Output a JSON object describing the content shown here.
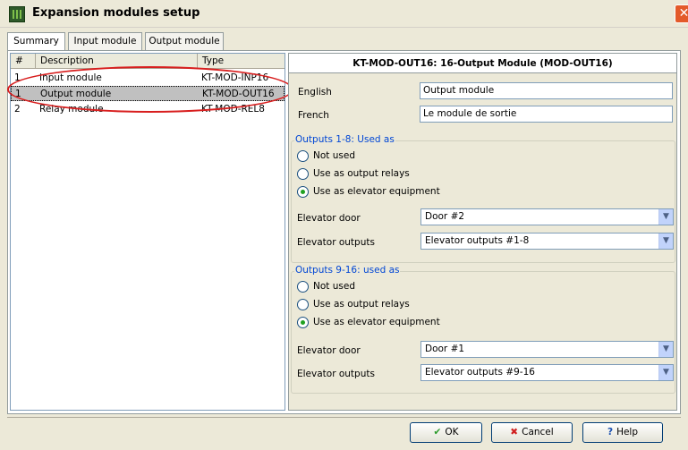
{
  "window": {
    "title": "Expansion modules setup",
    "close": "✕"
  },
  "tabs": [
    {
      "label": "Summary"
    },
    {
      "label": "Input module"
    },
    {
      "label": "Output module"
    }
  ],
  "list": {
    "headers": {
      "num": "#",
      "description": "Description",
      "type": "Type"
    },
    "rows": [
      {
        "num": "1",
        "description": "Input module",
        "type": "KT-MOD-INP16"
      },
      {
        "num": "1",
        "description": "Output module",
        "type": "KT-MOD-OUT16"
      },
      {
        "num": "2",
        "description": "Relay module",
        "type": "KT-MOD-REL8"
      }
    ],
    "selected_index": 1
  },
  "detail": {
    "heading": "KT-MOD-OUT16: 16-Output Module (MOD-OUT16)",
    "english_label": "English",
    "english_value": "Output module",
    "french_label": "French",
    "french_value": "Le module de sortie"
  },
  "group1": {
    "title": "Outputs 1-8: Used as",
    "options": [
      "Not used",
      "Use as output relays",
      "Use as elevator equipment"
    ],
    "selected": 2,
    "door_label": "Elevator door",
    "door_value": "Door #2",
    "outputs_label": "Elevator outputs",
    "outputs_value": "Elevator outputs #1-8"
  },
  "group2": {
    "title": "Outputs 9-16: used as",
    "options": [
      "Not used",
      "Use as output relays",
      "Use as elevator equipment"
    ],
    "selected": 2,
    "door_label": "Elevator door",
    "door_value": "Door #1",
    "outputs_label": "Elevator outputs",
    "outputs_value": "Elevator outputs #9-16"
  },
  "buttons": {
    "ok": "OK",
    "cancel": "Cancel",
    "help": "Help"
  },
  "icons": {
    "ok": "checkmark-icon",
    "cancel": "x-icon",
    "help": "question-icon"
  },
  "colors": {
    "annotation": "#d81e1e",
    "group_title": "#0046d5"
  }
}
